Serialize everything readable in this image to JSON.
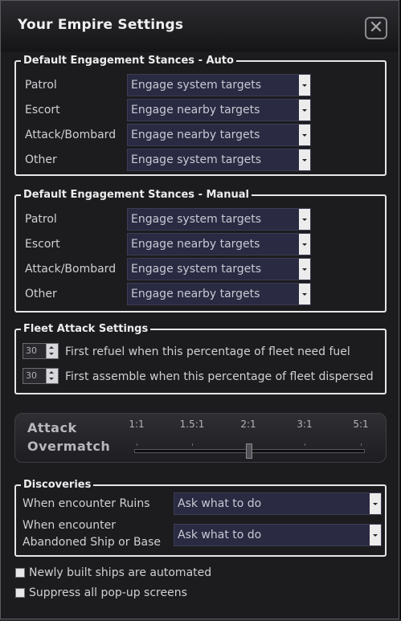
{
  "window": {
    "title": "Your Empire Settings",
    "close_icon": "close-icon"
  },
  "auto_group": {
    "legend": "Default Engagement Stances - Auto",
    "rows": [
      {
        "label": "Patrol",
        "value": "Engage system targets"
      },
      {
        "label": "Escort",
        "value": "Engage nearby targets"
      },
      {
        "label": "Attack/Bombard",
        "value": "Engage nearby targets"
      },
      {
        "label": "Other",
        "value": "Engage system targets"
      }
    ]
  },
  "manual_group": {
    "legend": "Default Engagement Stances - Manual",
    "rows": [
      {
        "label": "Patrol",
        "value": "Engage system targets"
      },
      {
        "label": "Escort",
        "value": "Engage nearby targets"
      },
      {
        "label": "Attack/Bombard",
        "value": "Engage system targets"
      },
      {
        "label": "Other",
        "value": "Engage nearby targets"
      }
    ]
  },
  "fleet_group": {
    "legend": "Fleet Attack Settings",
    "rows": [
      {
        "value": "30",
        "label": "First refuel when this percentage of fleet need fuel"
      },
      {
        "value": "30",
        "label": "First assemble when this percentage of fleet dispersed"
      }
    ]
  },
  "overmatch": {
    "label_line1": "Attack",
    "label_line2": "Overmatch",
    "ticks": [
      "1:1",
      "1.5:1",
      "2:1",
      "3:1",
      "5:1"
    ],
    "selected": "2:1"
  },
  "discoveries": {
    "legend": "Discoveries",
    "ruins_label": "When encounter Ruins",
    "ruins_value": "Ask what to do",
    "abandoned_label_line1": "When encounter",
    "abandoned_label_line2": "Abandoned Ship or Base",
    "abandoned_value": "Ask what to do"
  },
  "checkboxes": [
    {
      "label": "Newly built ships are automated",
      "checked": false
    },
    {
      "label": "Suppress all pop-up screens",
      "checked": false
    }
  ]
}
